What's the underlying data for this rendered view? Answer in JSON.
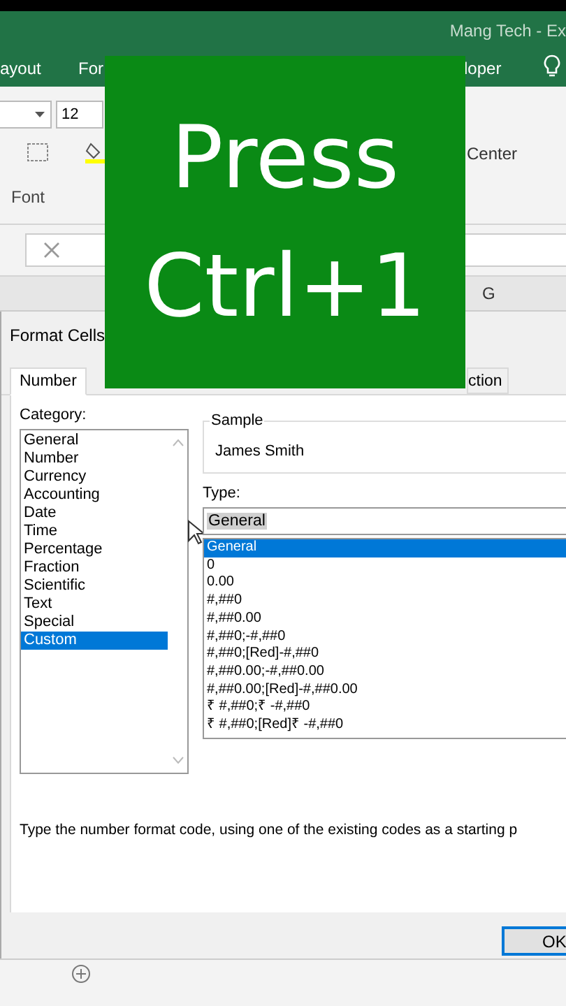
{
  "window": {
    "title": "Mang Tech - Ex"
  },
  "ribbon_tabs": [
    {
      "label": "ayout"
    },
    {
      "label": "For"
    },
    {
      "label": "loper"
    }
  ],
  "ribbon": {
    "font_size": "12",
    "font_group": "Font",
    "merge_label": "Center"
  },
  "column_headers": [
    "G"
  ],
  "overlay": {
    "lines": [
      "Press",
      "Ctrl+1"
    ]
  },
  "dialog": {
    "title": "Format Cells",
    "tabs": [
      {
        "label": "Number",
        "selected": true
      },
      {
        "label": "ction",
        "selected": false
      }
    ],
    "category_label": "Category:",
    "categories": [
      {
        "label": "General",
        "selected": false
      },
      {
        "label": "Number",
        "selected": false
      },
      {
        "label": "Currency",
        "selected": false
      },
      {
        "label": "Accounting",
        "selected": false
      },
      {
        "label": "Date",
        "selected": false
      },
      {
        "label": "Time",
        "selected": false
      },
      {
        "label": "Percentage",
        "selected": false
      },
      {
        "label": "Fraction",
        "selected": false
      },
      {
        "label": "Scientific",
        "selected": false
      },
      {
        "label": "Text",
        "selected": false
      },
      {
        "label": "Special",
        "selected": false
      },
      {
        "label": "Custom",
        "selected": true
      }
    ],
    "sample": {
      "label": "Sample",
      "value": "James Smith"
    },
    "type_label": "Type:",
    "type_value": "General",
    "types": [
      {
        "label": "General",
        "selected": true
      },
      {
        "label": "0",
        "selected": false
      },
      {
        "label": "0.00",
        "selected": false
      },
      {
        "label": "#,##0",
        "selected": false
      },
      {
        "label": "#,##0.00",
        "selected": false
      },
      {
        "label": "#,##0;-#,##0",
        "selected": false
      },
      {
        "label": "#,##0;[Red]-#,##0",
        "selected": false
      },
      {
        "label": "#,##0.00;-#,##0.00",
        "selected": false
      },
      {
        "label": "#,##0.00;[Red]-#,##0.00",
        "selected": false
      },
      {
        "label": "₹ #,##0;₹ -#,##0",
        "selected": false
      },
      {
        "label": "₹ #,##0;[Red]₹ -#,##0",
        "selected": false
      }
    ],
    "description": "Type the number format code, using one of the existing codes as a starting p",
    "ok_button": "OK"
  }
}
